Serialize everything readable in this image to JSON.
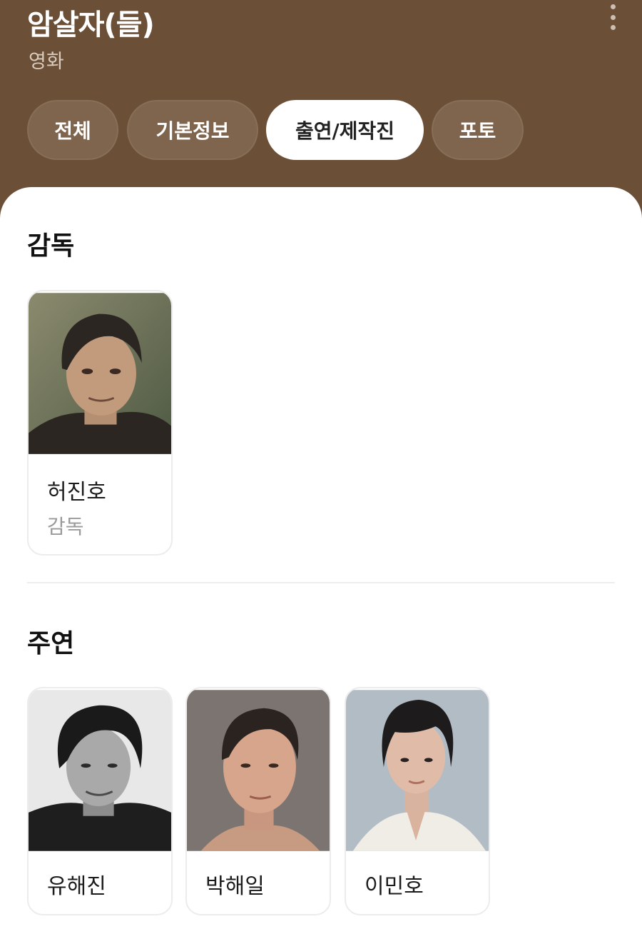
{
  "header": {
    "title": "암살자(들)",
    "category": "영화"
  },
  "tabs": [
    {
      "label": "전체",
      "active": false
    },
    {
      "label": "기본정보",
      "active": false
    },
    {
      "label": "출연/제작진",
      "active": true
    },
    {
      "label": "포토",
      "active": false
    }
  ],
  "sections": [
    {
      "title": "감독",
      "people": [
        {
          "name": "허진호",
          "role": "감독"
        }
      ]
    },
    {
      "title": "주연",
      "people": [
        {
          "name": "유해진"
        },
        {
          "name": "박해일"
        },
        {
          "name": "이민호"
        }
      ]
    }
  ],
  "colors": {
    "header_bg": "#6b4f37",
    "tab_bg": "#7f654d",
    "tab_active_bg": "#ffffff"
  }
}
